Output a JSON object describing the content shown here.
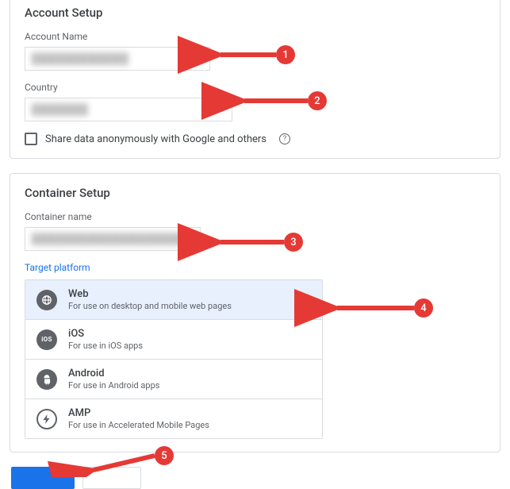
{
  "account": {
    "section_title": "Account Setup",
    "name_label": "Account Name",
    "name_value": "████████████",
    "country_label": "Country",
    "country_value": "███████",
    "share_label": "Share data anonymously with Google and others"
  },
  "container": {
    "section_title": "Container Setup",
    "name_label": "Container name",
    "name_value": "████████████████████",
    "target_label": "Target platform",
    "platforms": [
      {
        "title": "Web",
        "desc": "For use on desktop and mobile web pages",
        "selected": true
      },
      {
        "title": "iOS",
        "desc": "For use in iOS apps",
        "selected": false
      },
      {
        "title": "Android",
        "desc": "For use in Android apps",
        "selected": false
      },
      {
        "title": "AMP",
        "desc": "For use in Accelerated Mobile Pages",
        "selected": false
      }
    ]
  },
  "buttons": {
    "primary": "",
    "secondary": ""
  },
  "annotations": [
    "1",
    "2",
    "3",
    "4",
    "5"
  ]
}
